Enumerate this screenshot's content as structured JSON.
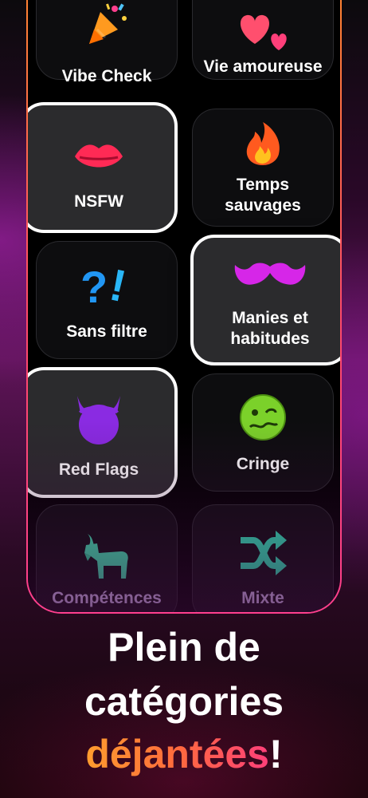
{
  "categories": [
    {
      "label": "Vibe Check",
      "icon": "party-popper-icon",
      "selected": false
    },
    {
      "label": "Vie amoureuse",
      "icon": "hearts-icon",
      "selected": false
    },
    {
      "label": "NSFW",
      "icon": "lips-icon",
      "selected": true
    },
    {
      "label": "Temps sauvages",
      "icon": "fire-icon",
      "selected": false
    },
    {
      "label": "Sans filtre",
      "icon": "question-exclamation-icon",
      "selected": false
    },
    {
      "label": "Manies et habitudes",
      "icon": "mustache-icon",
      "selected": true
    },
    {
      "label": "Red Flags",
      "icon": "devil-icon",
      "selected": true
    },
    {
      "label": "Cringe",
      "icon": "woozy-face-icon",
      "selected": false
    },
    {
      "label": "Compétences",
      "icon": "goat-icon",
      "selected": false
    },
    {
      "label": "Mixte",
      "icon": "shuffle-icon",
      "selected": false
    }
  ],
  "headline": {
    "line1": "Plein de",
    "line2": "catégories",
    "line3_accent": "déjantées",
    "line3_end": "!"
  },
  "colors": {
    "accent_orange": "#ff9d2e",
    "accent_pink": "#ff3f7a",
    "phone_border": "#ff6a4a",
    "card_bg": "#0d0d0f",
    "selected_card_bg": "#2b2b2d"
  }
}
